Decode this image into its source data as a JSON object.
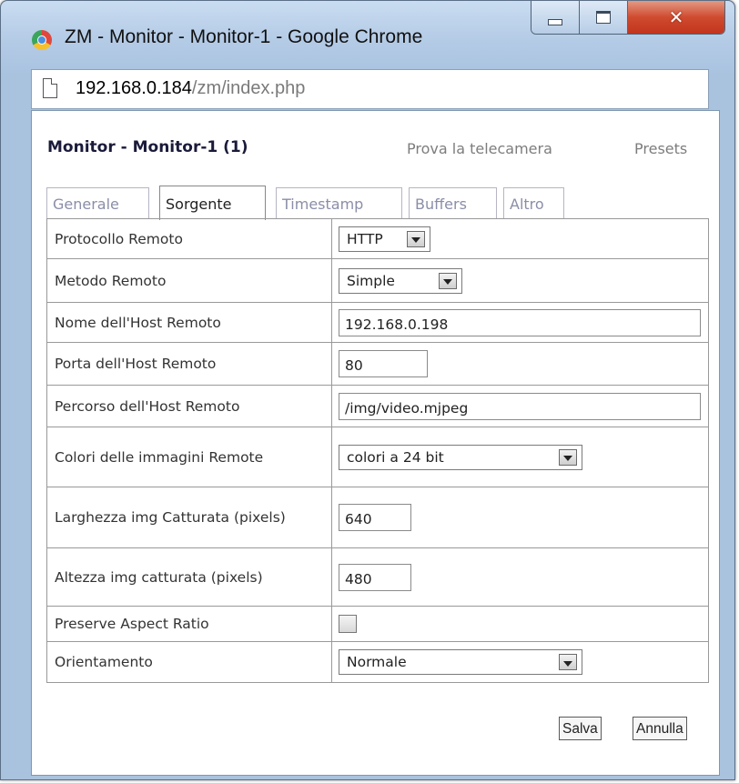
{
  "window": {
    "title": "ZM - Monitor - Monitor-1 - Google Chrome"
  },
  "address": {
    "host": "192.168.0.184",
    "path": "/zm/index.php"
  },
  "page": {
    "title": "Monitor - Monitor-1 (1)",
    "preview_link": "Prova la telecamera",
    "presets_link": "Presets"
  },
  "tabs": [
    {
      "label": "Generale",
      "active": false
    },
    {
      "label": "Sorgente",
      "active": true
    },
    {
      "label": "Timestamp",
      "active": false
    },
    {
      "label": "Buffers",
      "active": false
    },
    {
      "label": "Altro",
      "active": false
    }
  ],
  "fields": {
    "protocol": {
      "label": "Protocollo Remoto",
      "value": "HTTP"
    },
    "method": {
      "label": "Metodo Remoto",
      "value": "Simple"
    },
    "host": {
      "label": "Nome dell'Host Remoto",
      "value": "192.168.0.198"
    },
    "port": {
      "label": "Porta dell'Host Remoto",
      "value": "80"
    },
    "path": {
      "label": "Percorso dell'Host Remoto",
      "value": "/img/video.mjpeg"
    },
    "colours": {
      "label": "Colori delle immagini Remote",
      "value": "colori a 24 bit"
    },
    "width": {
      "label": "Larghezza img Catturata (pixels)",
      "value": "640"
    },
    "height": {
      "label": "Altezza img catturata (pixels)",
      "value": "480"
    },
    "aspect": {
      "label": "Preserve Aspect Ratio",
      "checked": false
    },
    "orientation": {
      "label": "Orientamento",
      "value": "Normale"
    }
  },
  "buttons": {
    "save": "Salva",
    "cancel": "Annulla"
  },
  "colors": {
    "titlebar": "#b4cbe6",
    "close_button": "#c9452a",
    "link_text": "#7d7d7d",
    "page_title": "#1a1a3a"
  }
}
